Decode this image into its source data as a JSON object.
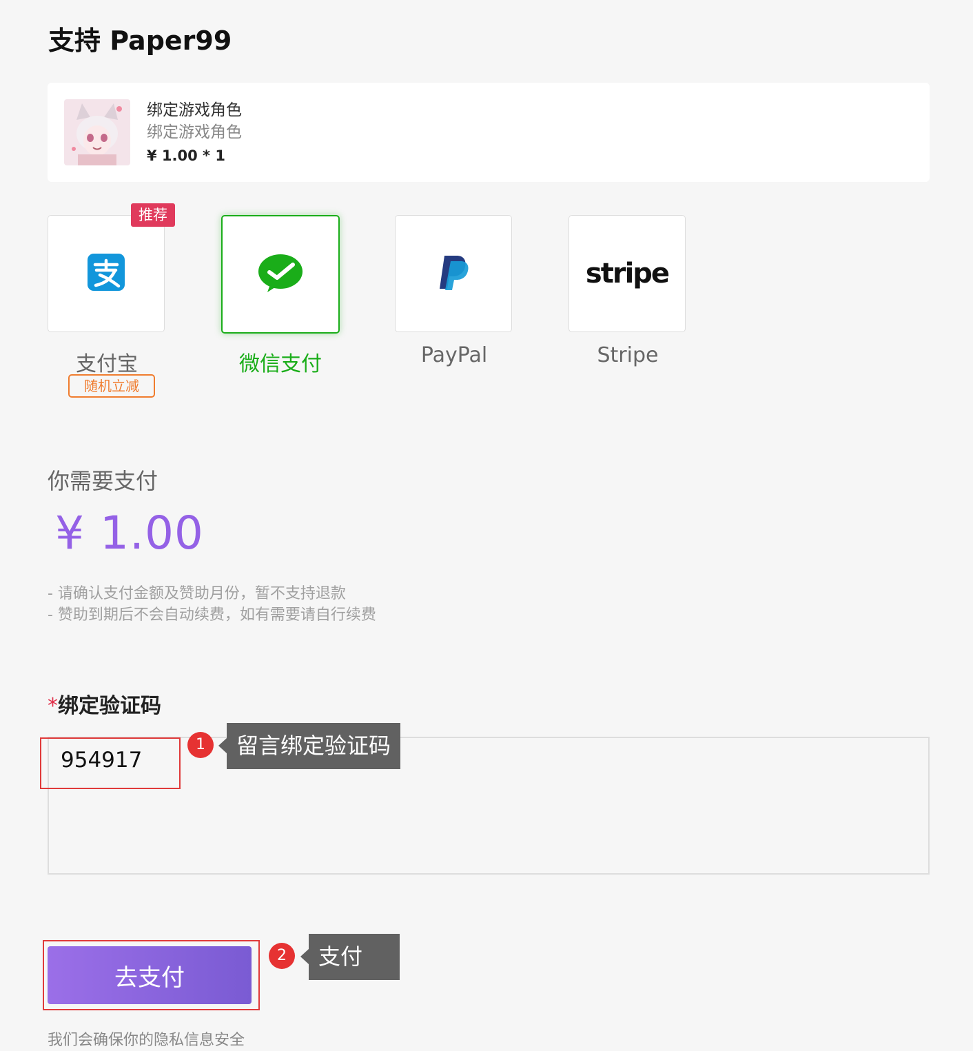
{
  "title": "支持 Paper99",
  "product": {
    "name": "绑定游戏角色",
    "description": "绑定游戏角色",
    "price": "¥ 1.00 * 1"
  },
  "payment_methods": [
    {
      "label": "支付宝",
      "icon": "alipay-icon",
      "badge": "推荐",
      "promo": "随机立减",
      "selected": false
    },
    {
      "label": "微信支付",
      "icon": "wechat-pay-icon",
      "selected": true
    },
    {
      "label": "PayPal",
      "icon": "paypal-icon",
      "selected": false
    },
    {
      "label": "Stripe",
      "icon": "stripe-icon",
      "icon_text": "stripe",
      "selected": false
    }
  ],
  "summary": {
    "heading": "你需要支付",
    "amount": "¥ 1.00",
    "notes": [
      "- 请确认支付金额及赞助月份，暂不支持退款",
      "- 赞助到期后不会自动续费，如有需要请自行续费"
    ]
  },
  "code_field": {
    "required_mark": "*",
    "label": "绑定验证码",
    "value": "954917"
  },
  "annotations": [
    {
      "number": "1",
      "text": "留言绑定验证码"
    },
    {
      "number": "2",
      "text": "支付"
    }
  ],
  "pay_button": "去支付",
  "privacy": "我们会确保你的隐私信息安全",
  "colors": {
    "accent": "#9461e6",
    "wechat_green": "#1aad19",
    "alipay_blue": "#1296db",
    "paypal_dark": "#253b80",
    "paypal_light": "#179bd7",
    "badge_red": "#e03a5c",
    "promo_orange": "#f07c2e",
    "annotation_red": "#e63232"
  }
}
